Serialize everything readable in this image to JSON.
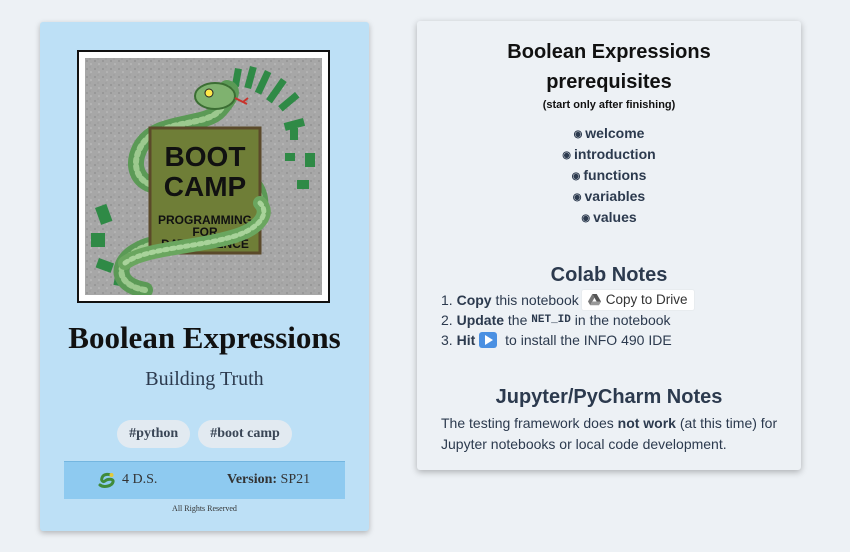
{
  "left_card": {
    "logo": {
      "alt_text_lines": [
        "BOOT",
        "CAMP",
        "PROGRAMMING",
        "FOR",
        "DATA SCIENCE"
      ]
    },
    "title": "Boolean Expressions",
    "subtitle": "Building Truth",
    "tags": [
      "#python",
      "#boot camp"
    ],
    "footer": {
      "ds_label": "4 D.S.",
      "version_label": "Version:",
      "version_value": "SP21"
    },
    "rights": "All Rights Reserved"
  },
  "right_card": {
    "title": "Boolean Expressions",
    "prereq_heading": "prerequisites",
    "prereq_note": "(start only after finishing)",
    "prerequisites": [
      "welcome",
      "introduction",
      "functions",
      "variables",
      "values"
    ],
    "colab": {
      "heading": "Colab Notes",
      "step1_num": "1.",
      "step1_bold": "Copy",
      "step1_text": " this notebook",
      "drive_button": "Copy to Drive",
      "step2_num": "2.",
      "step2_bold": "Update",
      "step2_pre": " the ",
      "step2_code": "NET_ID",
      "step2_post": " in the notebook",
      "step3_num": "3.",
      "step3_bold": "Hit",
      "step3_text": " to install the INFO 490 IDE"
    },
    "jupyter": {
      "heading": "Jupyter/PyCharm Notes",
      "text_pre": "The testing framework does ",
      "text_bold": "not work",
      "text_post": " (at this time) for Jupyter notebooks or local code development."
    }
  },
  "icons": {
    "radio": "radio-dot-icon",
    "drive": "google-drive-icon",
    "play": "play-button-icon",
    "snake": "snake-icon"
  },
  "colors": {
    "left_card_bg": "#bde0f6",
    "footer_band": "#8ecaf0",
    "tag_bg": "#e2eaf1",
    "right_card_bg": "#edf1f5",
    "text_dark": "#2c3a4e",
    "play_button": "#4a90e2"
  }
}
